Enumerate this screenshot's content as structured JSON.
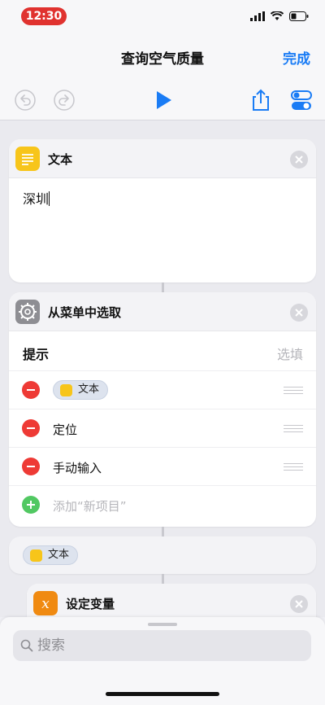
{
  "status": {
    "time": "12:30"
  },
  "nav": {
    "title": "查询空气质量",
    "done": "完成"
  },
  "cards": {
    "text_card": {
      "title": "文本",
      "content": "深圳"
    },
    "menu_card": {
      "title": "从菜单中选取",
      "prompt_label": "提示",
      "prompt_placeholder": "选填",
      "items": [
        "文本",
        "定位",
        "手动输入"
      ],
      "add_item": "添加“新项目”"
    },
    "var_chip": {
      "label": "文本"
    },
    "set_var_card": {
      "title": "设定变量"
    }
  },
  "sheet": {
    "search_placeholder": "搜索"
  },
  "colors": {
    "accent": "#1a7cf5",
    "delete": "#ee3a35",
    "add": "#51c862",
    "text_icon": "#f7c51a",
    "variable_icon": "#f08a11"
  }
}
